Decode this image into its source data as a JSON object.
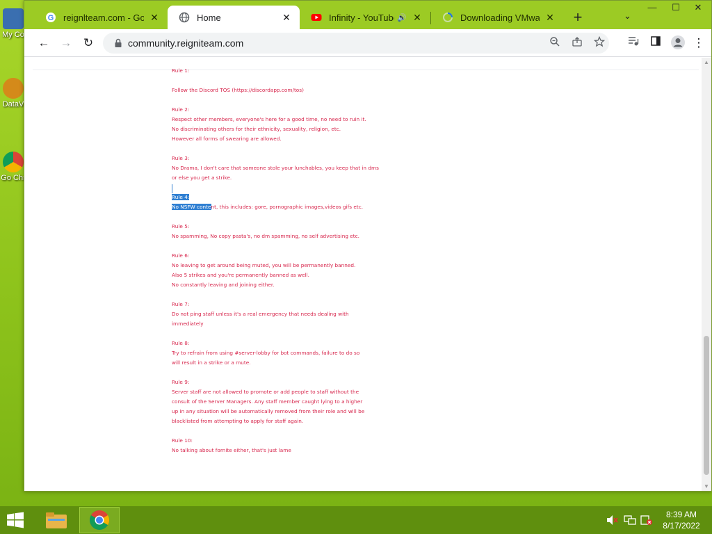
{
  "desktop": {
    "icons": [
      {
        "label": "My Co"
      },
      {
        "label": "DataV"
      },
      {
        "label": "Go Chr"
      }
    ]
  },
  "browser": {
    "tabs": [
      {
        "title": "reignlteam.com - Goog",
        "close": "✕"
      },
      {
        "title": "Home",
        "close": "✕"
      },
      {
        "title": "Infinity - YouTube",
        "close": "✕"
      },
      {
        "title": "Downloading VMware",
        "close": "✕"
      }
    ],
    "new_tab": "+",
    "tab_search": "⌄",
    "window_controls": {
      "minimize": "—",
      "maximize": "☐",
      "close": "✕"
    },
    "toolbar": {
      "back": "←",
      "forward": "→",
      "reload": "↻",
      "url": "community.reigniteam.com"
    }
  },
  "page": {
    "rules": [
      {
        "heading": "Rule 1:",
        "lines": [
          "Follow the Discord TOS (https://discordapp.com/tos)"
        ]
      },
      {
        "heading": "Rule 2:",
        "lines": [
          "Respect other members, everyone's here for a good time, no need to ruin it.",
          "No discriminating others for their ethnicity, sexuality, religion, etc.",
          "However all forms of swearing are allowed."
        ]
      },
      {
        "heading": "Rule 3:",
        "lines": [
          "No Drama, I don't care that someone stole your lunchables, you keep that in dms",
          "or else you get a strike."
        ]
      },
      {
        "heading": "Rule 4:",
        "line_selected": "No NSFW conte",
        "line_rest": "nt, this includes: gore, pornographic images,videos gifs etc."
      },
      {
        "heading": "Rule 5:",
        "lines": [
          "No spamming, No copy pasta's, no dm spamming, no self advertising etc."
        ]
      },
      {
        "heading": "Rule 6:",
        "lines": [
          "No leaving to get around being muted, you will be permanently banned.",
          "Also 5 strikes and you're permanently banned as well.",
          "No constantly leaving and joining either."
        ]
      },
      {
        "heading": "Rule 7:",
        "lines": [
          "Do not ping staff unless it's a real emergency that needs dealing with",
          "immediately"
        ]
      },
      {
        "heading": "Rule 8:",
        "lines": [
          "Try to refrain from using #server-lobby for bot commands, failure to do so",
          "will result in a strike or a mute."
        ]
      },
      {
        "heading": "Rule 9:",
        "lines": [
          "Server staff are not allowed to promote or add people to staff without the",
          "consult of the Server Managers. Any staff member caught lying to a higher",
          "up in any situation will be automatically removed from their role and will be",
          "blacklisted from attempting to apply for staff again."
        ]
      },
      {
        "heading": "Rule 10:",
        "lines": [
          "No talking about fornite either, that's just lame"
        ]
      }
    ]
  },
  "taskbar": {
    "time": "8:39 AM",
    "date": "8/17/2022"
  },
  "colors": {
    "rule_text": "#d7264c",
    "selection": "#2f7fd2",
    "tab_strip": "#9ccb24",
    "taskbar": "#5f8f0e"
  }
}
